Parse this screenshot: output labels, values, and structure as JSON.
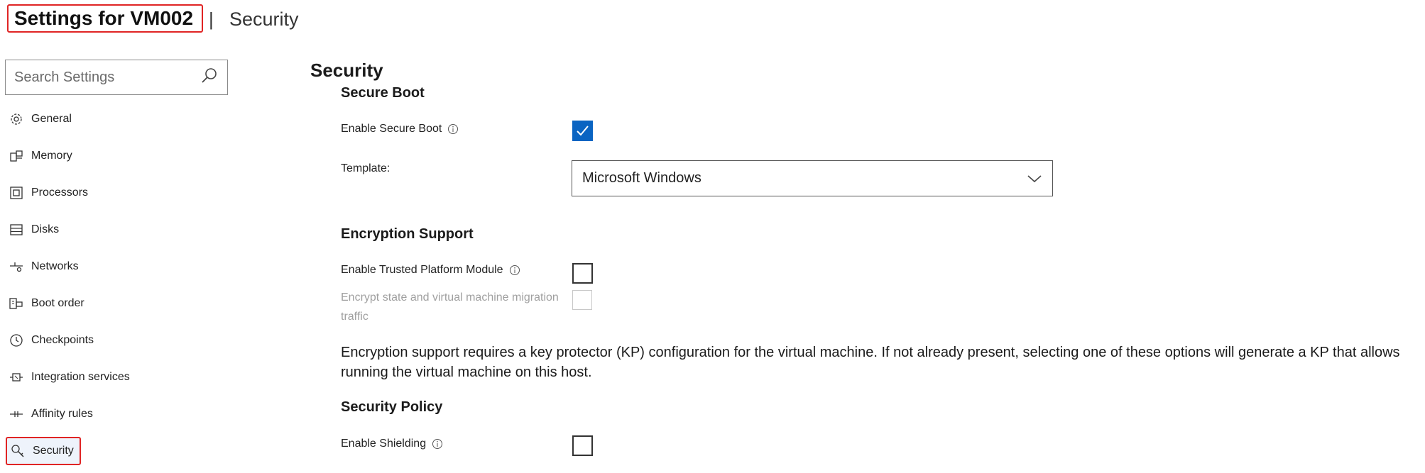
{
  "header": {
    "title": "Settings for VM002",
    "separator": "|",
    "subtitle": "Security"
  },
  "search": {
    "placeholder": "Search Settings",
    "icon": "search-icon"
  },
  "sidebar": {
    "items": [
      {
        "label": "General",
        "icon": "gear-icon"
      },
      {
        "label": "Memory",
        "icon": "memory-icon"
      },
      {
        "label": "Processors",
        "icon": "processor-icon"
      },
      {
        "label": "Disks",
        "icon": "disk-icon"
      },
      {
        "label": "Networks",
        "icon": "network-icon"
      },
      {
        "label": "Boot order",
        "icon": "boot-order-icon"
      },
      {
        "label": "Checkpoints",
        "icon": "clock-icon"
      },
      {
        "label": "Integration services",
        "icon": "integration-icon"
      },
      {
        "label": "Affinity rules",
        "icon": "affinity-icon"
      },
      {
        "label": "Security",
        "icon": "key-icon",
        "selected": true
      }
    ]
  },
  "main": {
    "title": "Security",
    "secure_boot": {
      "heading": "Secure Boot",
      "enable_label": "Enable Secure Boot",
      "enable_checked": true,
      "template_label": "Template:",
      "template_value": "Microsoft Windows"
    },
    "encryption": {
      "heading": "Encryption Support",
      "tpm_label": "Enable Trusted Platform Module",
      "tpm_checked": false,
      "encrypt_label": "Encrypt state and virtual machine migration traffic",
      "encrypt_checked": false,
      "encrypt_disabled": true,
      "note": "Encryption support requires a key protector (KP) configuration for the virtual machine. If not already present, selecting one of these options will generate a KP that allows running the virtual machine on this host."
    },
    "policy": {
      "heading": "Security Policy",
      "shielding_label": "Enable Shielding",
      "shielding_checked": false
    }
  },
  "colors": {
    "accent": "#0a64c2",
    "highlight_border": "#e02424"
  }
}
